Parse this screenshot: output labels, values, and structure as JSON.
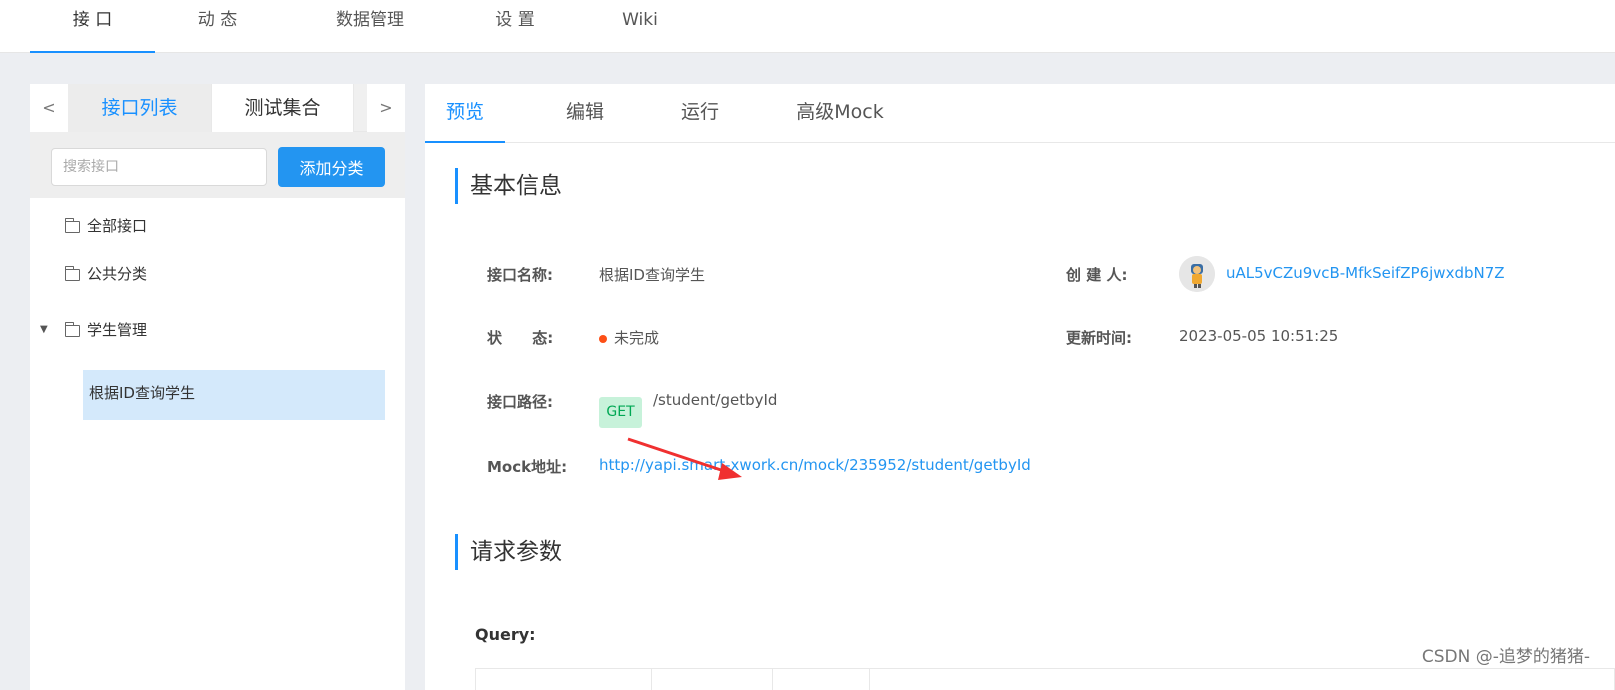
{
  "topnav": {
    "items": [
      {
        "label": "接 口"
      },
      {
        "label": "动 态"
      },
      {
        "label": "数据管理"
      },
      {
        "label": "设 置"
      },
      {
        "label": "Wiki"
      }
    ]
  },
  "sidebar": {
    "prev_arrow": "<",
    "next_arrow": ">",
    "tabs": [
      {
        "label": "接口列表"
      },
      {
        "label": "测试集合"
      }
    ],
    "search": {
      "placeholder": "搜索接口",
      "value": ""
    },
    "add_button": "添加分类",
    "tree": [
      {
        "label": "全部接口"
      },
      {
        "label": "公共分类"
      },
      {
        "label": "学生管理",
        "expanded": true,
        "children": [
          {
            "label": "根据ID查询学生"
          }
        ]
      }
    ]
  },
  "main": {
    "tabs": [
      {
        "label": "预览"
      },
      {
        "label": "编辑"
      },
      {
        "label": "运行"
      },
      {
        "label": "高级Mock"
      }
    ],
    "basic_info": {
      "title": "基本信息",
      "name_label": "接口名称:",
      "name_value": "根据ID查询学生",
      "creator_label": "创 建 人:",
      "creator_value": "uAL5vCZu9vcB-MfkSeifZP6jwxdbN7Z",
      "status_label": "状 态:",
      "status_value": "未完成",
      "status_color": "#fd4f16",
      "updated_label": "更新时间:",
      "updated_value": "2023-05-05 10:51:25",
      "path_label": "接口路径:",
      "method": "GET",
      "path_value": "/student/getbyId",
      "mock_label": "Mock地址:",
      "mock_value": "http://yapi.smart-xwork.cn/mock/235952/student/getbyId"
    },
    "request_params": {
      "title": "请求参数",
      "query_label": "Query:"
    }
  },
  "watermark": "CSDN @-追梦的猪猪-",
  "colors": {
    "accent": "#1890ff",
    "button": "#2395f1",
    "selected_bg": "#d4e9fb",
    "get_tag_bg": "#c7f2da",
    "get_tag_text": "#00a854",
    "annotation_arrow": "#f03030"
  }
}
